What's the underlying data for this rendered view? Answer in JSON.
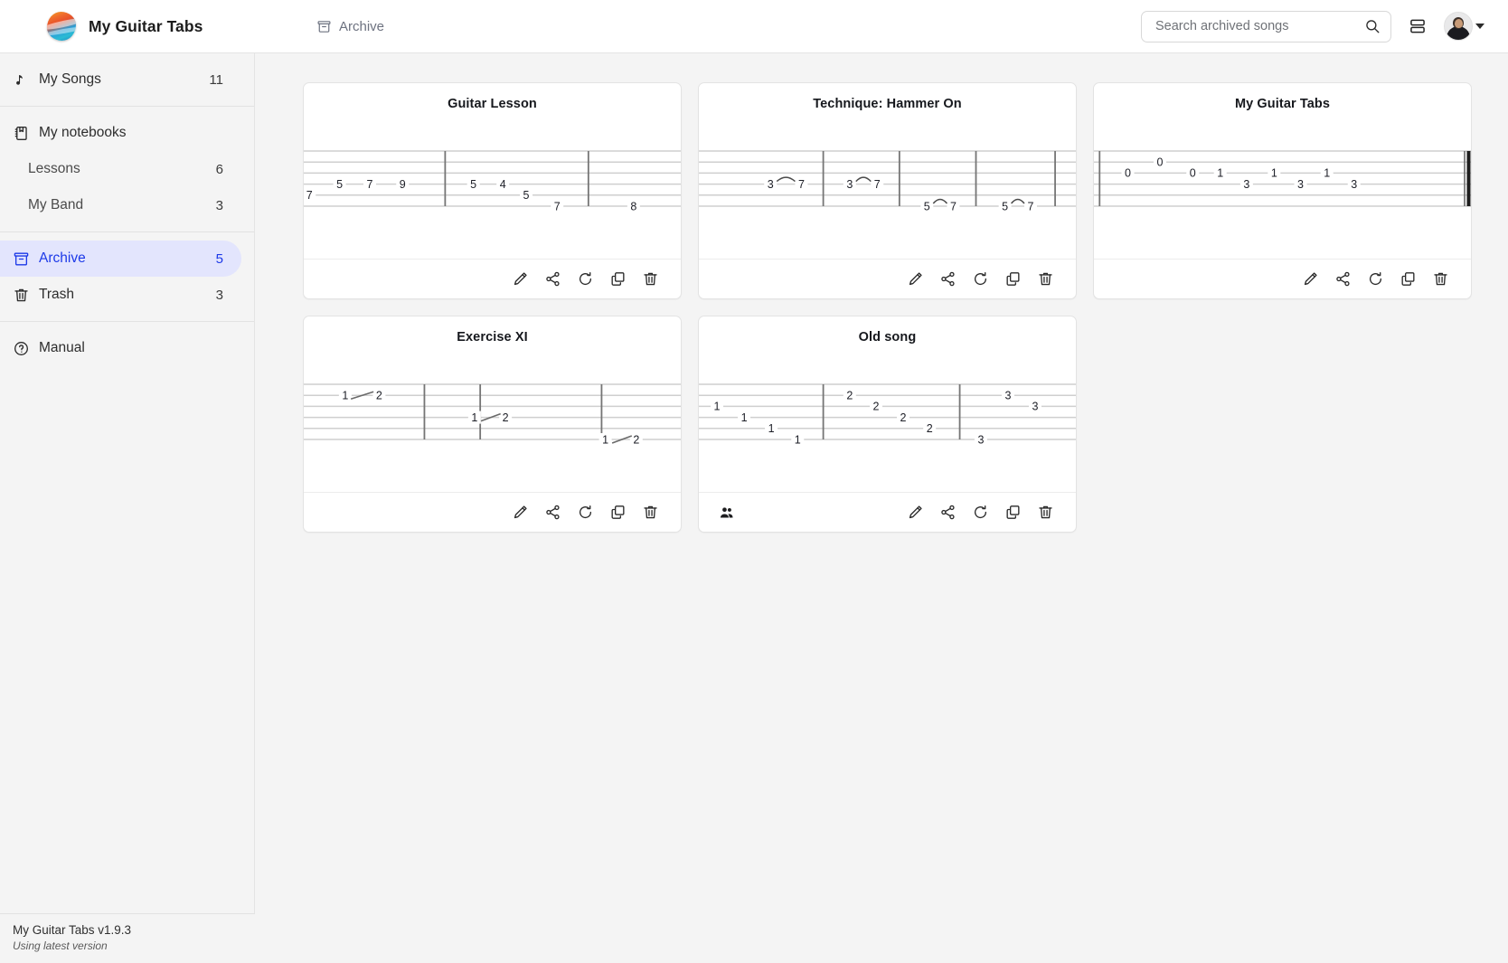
{
  "app": {
    "brand_name": "My Guitar Tabs",
    "logo_icon": "app-logo-icon",
    "version": "My Guitar Tabs v1.9.3",
    "version_status": "Using latest version"
  },
  "header": {
    "breadcrumb_icon": "archive-box-icon",
    "breadcrumb_label": "Archive",
    "search_placeholder": "Search archived songs",
    "search_value": "",
    "search_icon": "search-icon",
    "view_toggle_icon": "list-view-icon",
    "avatar_icon": "user-avatar",
    "avatar_caret_icon": "chevron-down-icon"
  },
  "sidebar": {
    "groups": [
      {
        "items": [
          {
            "icon": "music-note-icon",
            "label": "My Songs",
            "count": "11",
            "active": false,
            "indent": false
          }
        ]
      },
      {
        "items": [
          {
            "icon": "notebook-icon",
            "label": "My notebooks",
            "count": "",
            "active": false,
            "indent": false
          },
          {
            "icon": "",
            "label": "Lessons",
            "count": "6",
            "active": false,
            "indent": true
          },
          {
            "icon": "",
            "label": "My Band",
            "count": "3",
            "active": false,
            "indent": true
          }
        ]
      },
      {
        "items": [
          {
            "icon": "archive-box-icon",
            "label": "Archive",
            "count": "5",
            "active": true,
            "indent": false
          },
          {
            "icon": "trash-icon",
            "label": "Trash",
            "count": "3",
            "active": false,
            "indent": false
          }
        ]
      },
      {
        "items": [
          {
            "icon": "question-circle-icon",
            "label": "Manual",
            "count": "",
            "active": false,
            "indent": false
          }
        ]
      }
    ]
  },
  "main": {
    "action_icons": [
      "pencil-icon",
      "share-icon",
      "restore-icon",
      "duplicate-icon",
      "trash-icon"
    ],
    "action_labels": [
      "Edit",
      "Share",
      "Restore",
      "Duplicate",
      "Delete"
    ],
    "cards": [
      {
        "title": "Guitar Lesson",
        "shared": false,
        "end_barline": false,
        "tab": {
          "strings": 6,
          "barlines": [
            0.375,
            0.755
          ],
          "notes": [
            {
              "string": 4,
              "x": 0.015,
              "fret": "7"
            },
            {
              "string": 3,
              "x": 0.095,
              "fret": "5"
            },
            {
              "string": 3,
              "x": 0.175,
              "fret": "7"
            },
            {
              "string": 3,
              "x": 0.262,
              "fret": "9"
            },
            {
              "string": 3,
              "x": 0.45,
              "fret": "5"
            },
            {
              "string": 3,
              "x": 0.528,
              "fret": "4"
            },
            {
              "string": 4,
              "x": 0.59,
              "fret": "5"
            },
            {
              "string": 5,
              "x": 0.672,
              "fret": "7"
            },
            {
              "string": 5,
              "x": 0.875,
              "fret": "8"
            }
          ],
          "slurs": [],
          "slides": []
        }
      },
      {
        "title": "Technique: Hammer On",
        "shared": false,
        "end_barline": false,
        "tab": {
          "strings": 6,
          "barlines": [
            0.33,
            0.532,
            0.735,
            0.945
          ],
          "notes": [
            {
              "string": 3,
              "x": 0.19,
              "fret": "3"
            },
            {
              "string": 3,
              "x": 0.272,
              "fret": "7"
            },
            {
              "string": 3,
              "x": 0.4,
              "fret": "3"
            },
            {
              "string": 3,
              "x": 0.473,
              "fret": "7"
            },
            {
              "string": 5,
              "x": 0.605,
              "fret": "5"
            },
            {
              "string": 5,
              "x": 0.675,
              "fret": "7"
            },
            {
              "string": 5,
              "x": 0.812,
              "fret": "5"
            },
            {
              "string": 5,
              "x": 0.88,
              "fret": "7"
            }
          ],
          "slurs": [
            {
              "string": 3,
              "x1": 0.19,
              "x2": 0.272
            },
            {
              "string": 3,
              "x1": 0.4,
              "x2": 0.473
            },
            {
              "string": 5,
              "x1": 0.605,
              "x2": 0.675
            },
            {
              "string": 5,
              "x1": 0.812,
              "x2": 0.88
            }
          ],
          "slides": []
        }
      },
      {
        "title": "My Guitar Tabs",
        "shared": false,
        "end_barline": true,
        "tab": {
          "strings": 6,
          "barlines": [
            0.015
          ],
          "notes": [
            {
              "string": 1,
              "x": 0.175,
              "fret": "0"
            },
            {
              "string": 2,
              "x": 0.09,
              "fret": "0"
            },
            {
              "string": 2,
              "x": 0.262,
              "fret": "0"
            },
            {
              "string": 2,
              "x": 0.335,
              "fret": "1"
            },
            {
              "string": 2,
              "x": 0.478,
              "fret": "1"
            },
            {
              "string": 2,
              "x": 0.618,
              "fret": "1"
            },
            {
              "string": 3,
              "x": 0.405,
              "fret": "3"
            },
            {
              "string": 3,
              "x": 0.548,
              "fret": "3"
            },
            {
              "string": 3,
              "x": 0.69,
              "fret": "3"
            }
          ],
          "slurs": [],
          "slides": []
        }
      },
      {
        "title": "Exercise XI",
        "shared": false,
        "end_barline": false,
        "tab": {
          "strings": 6,
          "barlines": [
            0.32,
            0.468,
            0.79
          ],
          "notes": [
            {
              "string": 1,
              "x": 0.11,
              "fret": "1"
            },
            {
              "string": 1,
              "x": 0.2,
              "fret": "2"
            },
            {
              "string": 3,
              "x": 0.453,
              "fret": "1"
            },
            {
              "string": 3,
              "x": 0.535,
              "fret": "2"
            },
            {
              "string": 5,
              "x": 0.8,
              "fret": "1"
            },
            {
              "string": 5,
              "x": 0.882,
              "fret": "2"
            }
          ],
          "slurs": [],
          "slides": [
            {
              "string": 1,
              "x1": 0.125,
              "x2": 0.185
            },
            {
              "string": 3,
              "x1": 0.47,
              "x2": 0.522
            },
            {
              "string": 5,
              "x1": 0.818,
              "x2": 0.87
            }
          ]
        }
      },
      {
        "title": "Old song",
        "shared": true,
        "shared_icon": "people-icon",
        "end_barline": false,
        "tab": {
          "strings": 6,
          "barlines": [
            0.33,
            0.692
          ],
          "notes": [
            {
              "string": 2,
              "x": 0.048,
              "fret": "1"
            },
            {
              "string": 3,
              "x": 0.12,
              "fret": "1"
            },
            {
              "string": 4,
              "x": 0.192,
              "fret": "1"
            },
            {
              "string": 5,
              "x": 0.262,
              "fret": "1"
            },
            {
              "string": 1,
              "x": 0.4,
              "fret": "2"
            },
            {
              "string": 2,
              "x": 0.47,
              "fret": "2"
            },
            {
              "string": 3,
              "x": 0.542,
              "fret": "2"
            },
            {
              "string": 4,
              "x": 0.612,
              "fret": "2"
            },
            {
              "string": 1,
              "x": 0.82,
              "fret": "3"
            },
            {
              "string": 2,
              "x": 0.892,
              "fret": "3"
            },
            {
              "string": 5,
              "x": 0.748,
              "fret": "3"
            }
          ],
          "slurs": [],
          "slides": []
        }
      }
    ]
  },
  "colors": {
    "accent": "#1c39e8",
    "accent_bg": "#e3e5fd",
    "page_bg": "#f4f4f4",
    "card_bg": "#ffffff",
    "staff_line": "#cfcfcf",
    "barline": "#757575",
    "note_text": "#1d1f27"
  }
}
